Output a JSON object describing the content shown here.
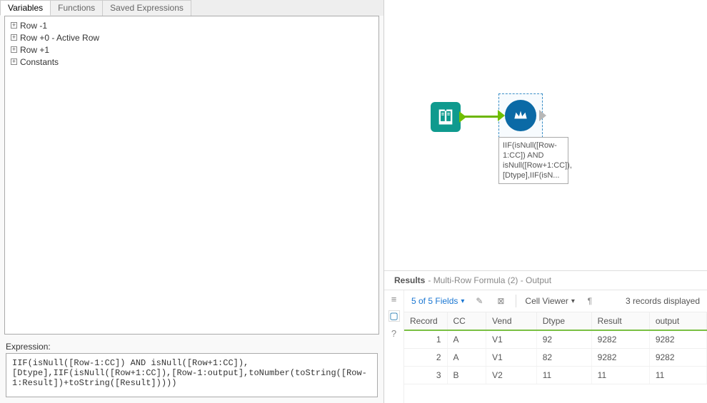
{
  "left": {
    "tabs": [
      "Variables",
      "Functions",
      "Saved Expressions"
    ],
    "activeTab": 0,
    "tree": [
      {
        "label": "Row -1"
      },
      {
        "label": "Row +0 - Active Row"
      },
      {
        "label": "Row +1"
      },
      {
        "label": "Constants"
      }
    ],
    "expressionLabel": "Expression:",
    "expression": "IIF(isNull([Row-1:CC]) AND isNull([Row+1:CC]),[Dtype],IIF(isNull([Row+1:CC]),[Row-1:output],toNumber(toString([Row-1:Result])+toString([Result]))))"
  },
  "canvas": {
    "formulaCaption": "IIF(isNull([Row-1:CC]) AND isNull([Row+1:CC]),[Dtype],IIF(isN..."
  },
  "results": {
    "title": "Results",
    "subtitle": "- Multi-Row Formula (2) - Output",
    "fieldsLabel": "5 of 5 Fields",
    "cellViewerLabel": "Cell Viewer",
    "recordsLabel": "3 records displayed",
    "columns": [
      "Record",
      "CC",
      "Vend",
      "Dtype",
      "Result",
      "output"
    ],
    "rows": [
      {
        "Record": "1",
        "CC": "A",
        "Vend": "V1",
        "Dtype": "92",
        "Result": "9282",
        "output": "9282"
      },
      {
        "Record": "2",
        "CC": "A",
        "Vend": "V1",
        "Dtype": "82",
        "Result": "9282",
        "output": "9282"
      },
      {
        "Record": "3",
        "CC": "B",
        "Vend": "V2",
        "Dtype": "11",
        "Result": "11",
        "output": "11"
      }
    ]
  }
}
